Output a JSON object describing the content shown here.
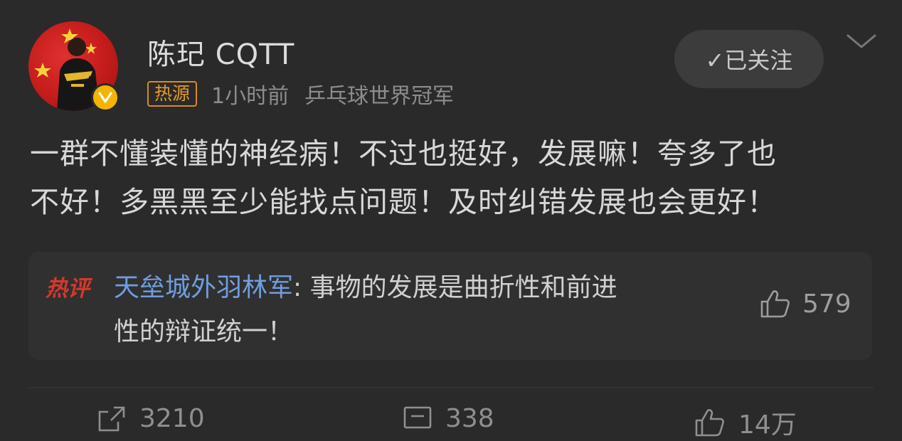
{
  "post": {
    "author": {
      "name": "陈玘 CQTT",
      "badge": "热源",
      "time": "1小时前",
      "source": "乒乓球世界冠军"
    },
    "follow_button": "✓已关注",
    "text_lines": [
      "一群不懂装懂的神经病！不过也挺好，发展嘛！夸多了也",
      "不好！多黑黑至少能找点问题！及时纠错发展也会更好！"
    ],
    "hot_comment": {
      "badge": "热评",
      "author": "天垒城外羽林军",
      "separator": ": ",
      "line1": "事物的发展是曲折性和前进",
      "line2": "性的辩证统一！",
      "likes": "579"
    },
    "actions": {
      "repost": "3210",
      "comment": "338",
      "like": "14万"
    }
  },
  "colors": {
    "background": "#2a2a2a",
    "hot_tag": "#e59a2c",
    "comment_author": "#6f9ee0",
    "hot_comment_badge": "#d6372c",
    "verified": "#f4b400"
  }
}
